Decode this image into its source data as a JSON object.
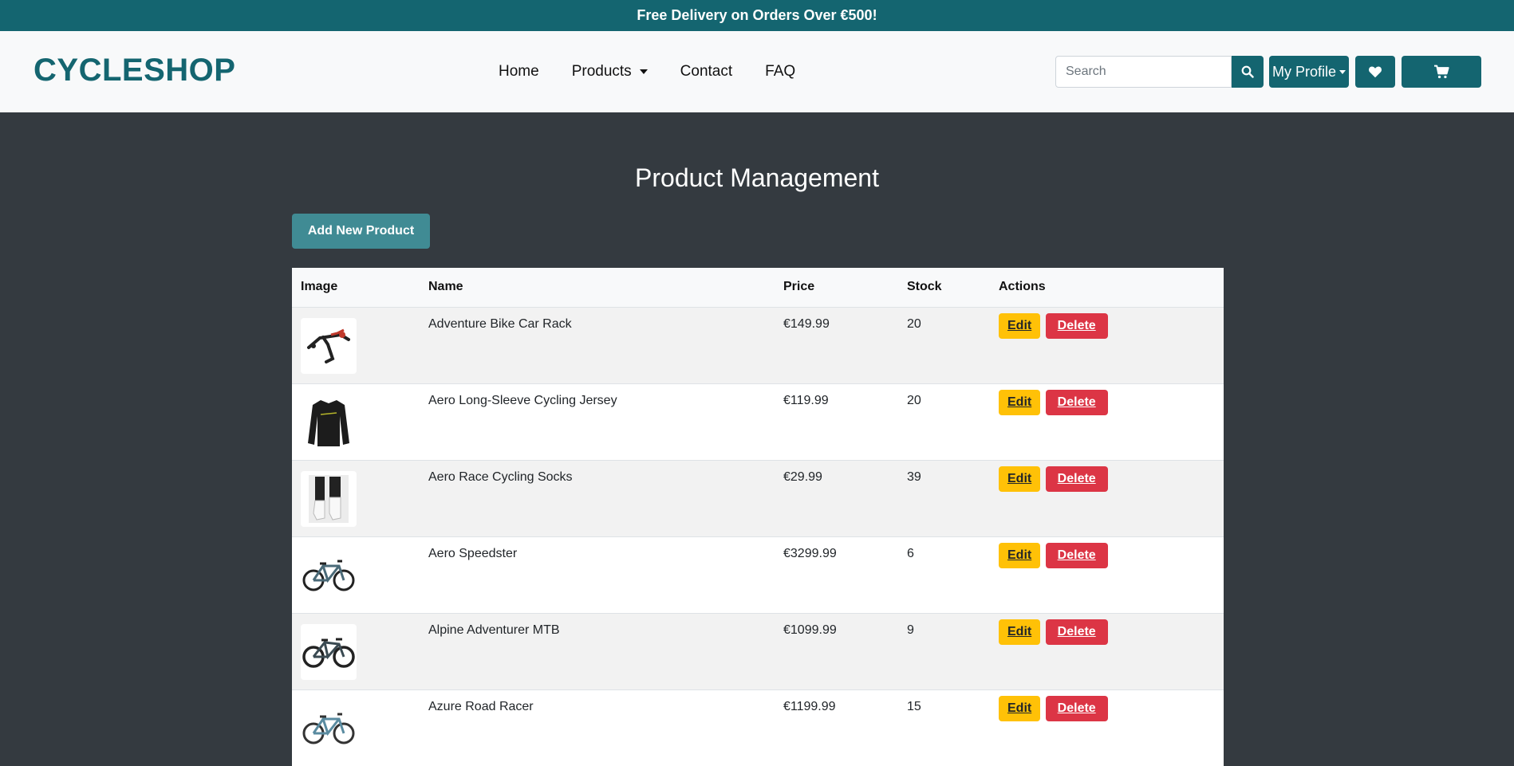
{
  "promo_banner": "Free Delivery on Orders Over €500!",
  "brand": "CYCLESHOP",
  "nav": {
    "home": "Home",
    "products": "Products",
    "contact": "Contact",
    "faq": "FAQ"
  },
  "search": {
    "placeholder": "Search",
    "value": ""
  },
  "profile_label": "My Profile",
  "page_title": "Product Management",
  "add_button": "Add New Product",
  "table": {
    "headers": [
      "Image",
      "Name",
      "Price",
      "Stock",
      "Actions"
    ],
    "rows": [
      {
        "image": "bike-rack-icon",
        "name": "Adventure Bike Car Rack",
        "price": "€149.99",
        "stock": "20"
      },
      {
        "image": "jersey-icon",
        "name": "Aero Long-Sleeve Cycling Jersey",
        "price": "€119.99",
        "stock": "20"
      },
      {
        "image": "socks-icon",
        "name": "Aero Race Cycling Socks",
        "price": "€29.99",
        "stock": "39"
      },
      {
        "image": "road-bike-icon",
        "name": "Aero Speedster",
        "price": "€3299.99",
        "stock": "6"
      },
      {
        "image": "mtb-icon",
        "name": "Alpine Adventurer MTB",
        "price": "€1099.99",
        "stock": "9"
      },
      {
        "image": "road-bike-icon",
        "name": "Azure Road Racer",
        "price": "€1199.99",
        "stock": "15"
      }
    ],
    "edit_label": "Edit",
    "delete_label": "Delete"
  },
  "colors": {
    "brand_teal": "#146570",
    "add_button": "#408b94",
    "edit": "#ffc107",
    "delete": "#dc3545",
    "background": "#343a40"
  }
}
